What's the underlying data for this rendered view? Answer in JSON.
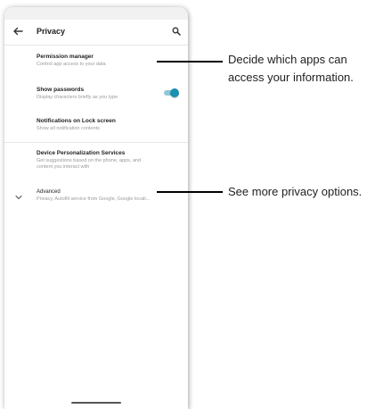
{
  "appbar": {
    "title": "Privacy",
    "back_icon": "arrow-back-icon",
    "search_icon": "search-icon"
  },
  "preferences": {
    "permission_manager": {
      "title": "Permission manager",
      "summary": "Control app access to your data"
    },
    "show_passwords": {
      "title": "Show passwords",
      "summary": "Display characters briefly as you type",
      "toggle_on": true
    },
    "lock_screen": {
      "title": "Notifications on Lock screen",
      "summary": "Show all notification contents"
    },
    "personalization": {
      "title": "Device Personalization Services",
      "summary_line1": "Get suggestions based on the phone, apps, and",
      "summary_line2": "content you interact with"
    },
    "advanced": {
      "title": "Advanced",
      "summary": "Privacy, Autofill service from Google, Google locati..."
    }
  },
  "callouts": {
    "permissions_line1": "Decide which apps can",
    "permissions_line2": "access your information.",
    "advanced": "See more privacy options."
  },
  "colors": {
    "toggle_thumb": "#1a8fb0",
    "toggle_track": "#8ec7d6"
  }
}
